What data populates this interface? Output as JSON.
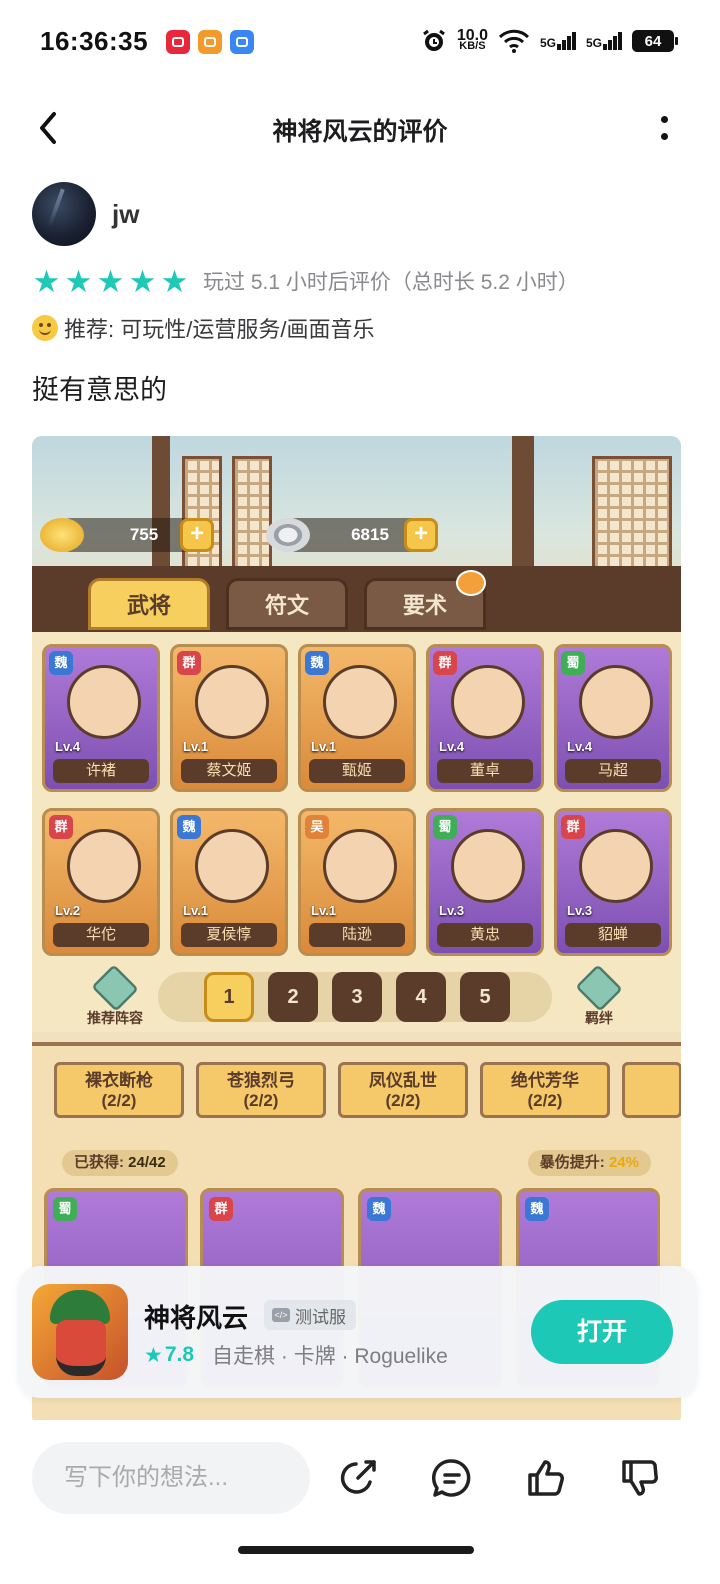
{
  "status_bar": {
    "time": "16:36:35",
    "net_speed_value": "10.0",
    "net_speed_unit": "KB/S",
    "signal_1": "5G",
    "signal_2": "5G",
    "battery": "64"
  },
  "header": {
    "title": "神将风云的评价"
  },
  "review": {
    "username": "jw",
    "stars": 5,
    "play_time": "玩过 5.1 小时后评价（总时长 5.2 小时）",
    "recommend": "推荐: 可玩性/运营服务/画面音乐",
    "text": "挺有意思的"
  },
  "screenshot": {
    "currency_1": "755",
    "currency_2": "6815",
    "tabs": [
      "武将",
      "符文",
      "要术"
    ],
    "heroes": [
      {
        "name": "许褚",
        "lv": "Lv.4",
        "faction": "魏",
        "color": "purple"
      },
      {
        "name": "蔡文姬",
        "lv": "Lv.1",
        "faction": "群",
        "color": "orange"
      },
      {
        "name": "甄姬",
        "lv": "Lv.1",
        "faction": "魏",
        "color": "orange"
      },
      {
        "name": "董卓",
        "lv": "Lv.4",
        "faction": "群",
        "color": "purple"
      },
      {
        "name": "马超",
        "lv": "Lv.4",
        "faction": "蜀",
        "color": "purple"
      },
      {
        "name": "华佗",
        "lv": "Lv.2",
        "faction": "群",
        "color": "orange"
      },
      {
        "name": "夏侯惇",
        "lv": "Lv.1",
        "faction": "魏",
        "color": "orange"
      },
      {
        "name": "陆逊",
        "lv": "Lv.1",
        "faction": "吴",
        "color": "orange"
      },
      {
        "name": "黄忠",
        "lv": "Lv.3",
        "faction": "蜀",
        "color": "purple"
      },
      {
        "name": "貂蝉",
        "lv": "Lv.3",
        "faction": "群",
        "color": "purple"
      }
    ],
    "pages": [
      "1",
      "2",
      "3",
      "4",
      "5"
    ],
    "left_badge": "推荐阵容",
    "right_badge": "羁绊",
    "bonds": [
      {
        "name": "裸衣断枪",
        "count": "(2/2)"
      },
      {
        "name": "苍狼烈弓",
        "count": "(2/2)"
      },
      {
        "name": "凤仪乱世",
        "count": "(2/2)"
      },
      {
        "name": "绝代芳华",
        "count": "(2/2)"
      }
    ],
    "obtained_label": "已获得:",
    "obtained_value": "24/42",
    "crit_label": "暴伤提升:",
    "crit_value": "24%",
    "lower_factions": [
      "蜀",
      "群",
      "魏",
      "魏"
    ]
  },
  "app_card": {
    "name": "神将风云",
    "badge": "测试服",
    "score": "7.8",
    "tags": "自走棋 · 卡牌 · Roguelike",
    "open_label": "打开"
  },
  "bottom_bar": {
    "input_placeholder": "写下你的想法..."
  },
  "colors": {
    "accent": "#1ec8b6",
    "text_primary": "#1d1d1f",
    "text_secondary": "#8a8a8e"
  }
}
